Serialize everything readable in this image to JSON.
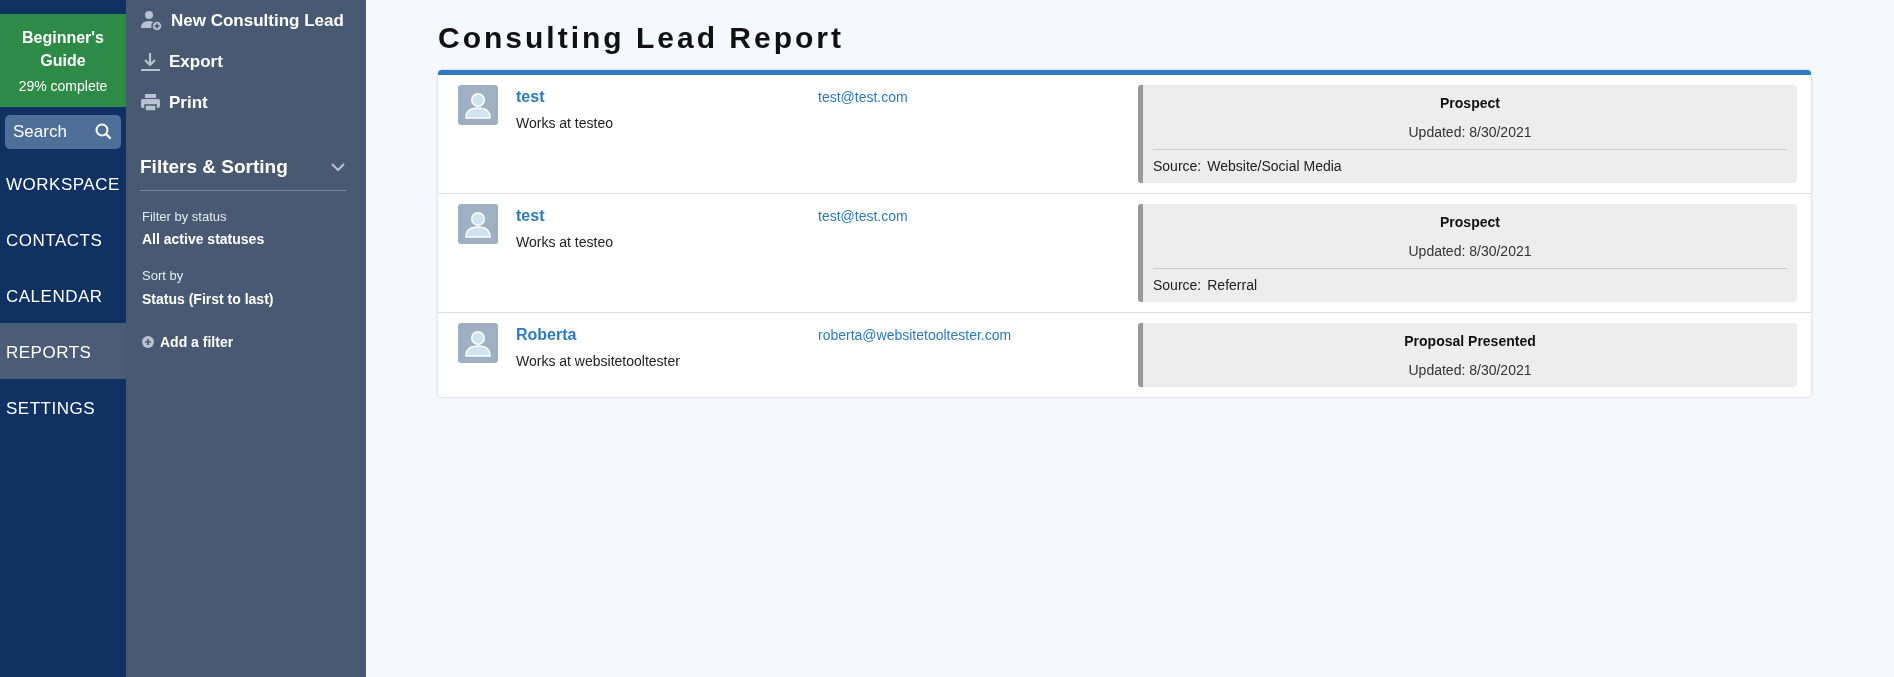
{
  "guide": {
    "title": "Beginner's Guide",
    "progress": "29% complete"
  },
  "search": {
    "placeholder": "Search"
  },
  "nav": [
    {
      "label": "WORKSPACE",
      "selected": false
    },
    {
      "label": "CONTACTS",
      "selected": false
    },
    {
      "label": "CALENDAR",
      "selected": false
    },
    {
      "label": "REPORTS",
      "selected": true
    },
    {
      "label": "SETTINGS",
      "selected": false
    }
  ],
  "actions": [
    {
      "kind": "add-person",
      "label": "New Consulting Lead"
    },
    {
      "kind": "download",
      "label": "Export"
    },
    {
      "kind": "print",
      "label": "Print"
    }
  ],
  "filters": {
    "title": "Filters & Sorting",
    "expanded": true,
    "groups": [
      {
        "label": "Filter by status",
        "value": "All active statuses"
      },
      {
        "label": "Sort by",
        "value": "Status (First to last)"
      }
    ],
    "add": "Add a filter"
  },
  "page_title": "Consulting Lead Report",
  "leads": [
    {
      "name": "test",
      "company": "Works at testeo",
      "email": "test@test.com",
      "status": "Prospect",
      "updated": "Updated: 8/30/2021",
      "source_label": "Source:",
      "source": "Website/Social Media"
    },
    {
      "name": "test",
      "company": "Works at testeo",
      "email": "test@test.com",
      "status": "Prospect",
      "updated": "Updated: 8/30/2021",
      "source_label": "Source:",
      "source": "Referral"
    },
    {
      "name": "Roberta",
      "company": "Works at websitetooltester",
      "email": "roberta@websitetooltester.com",
      "status": "Proposal Presented",
      "updated": "Updated: 8/30/2021"
    }
  ]
}
